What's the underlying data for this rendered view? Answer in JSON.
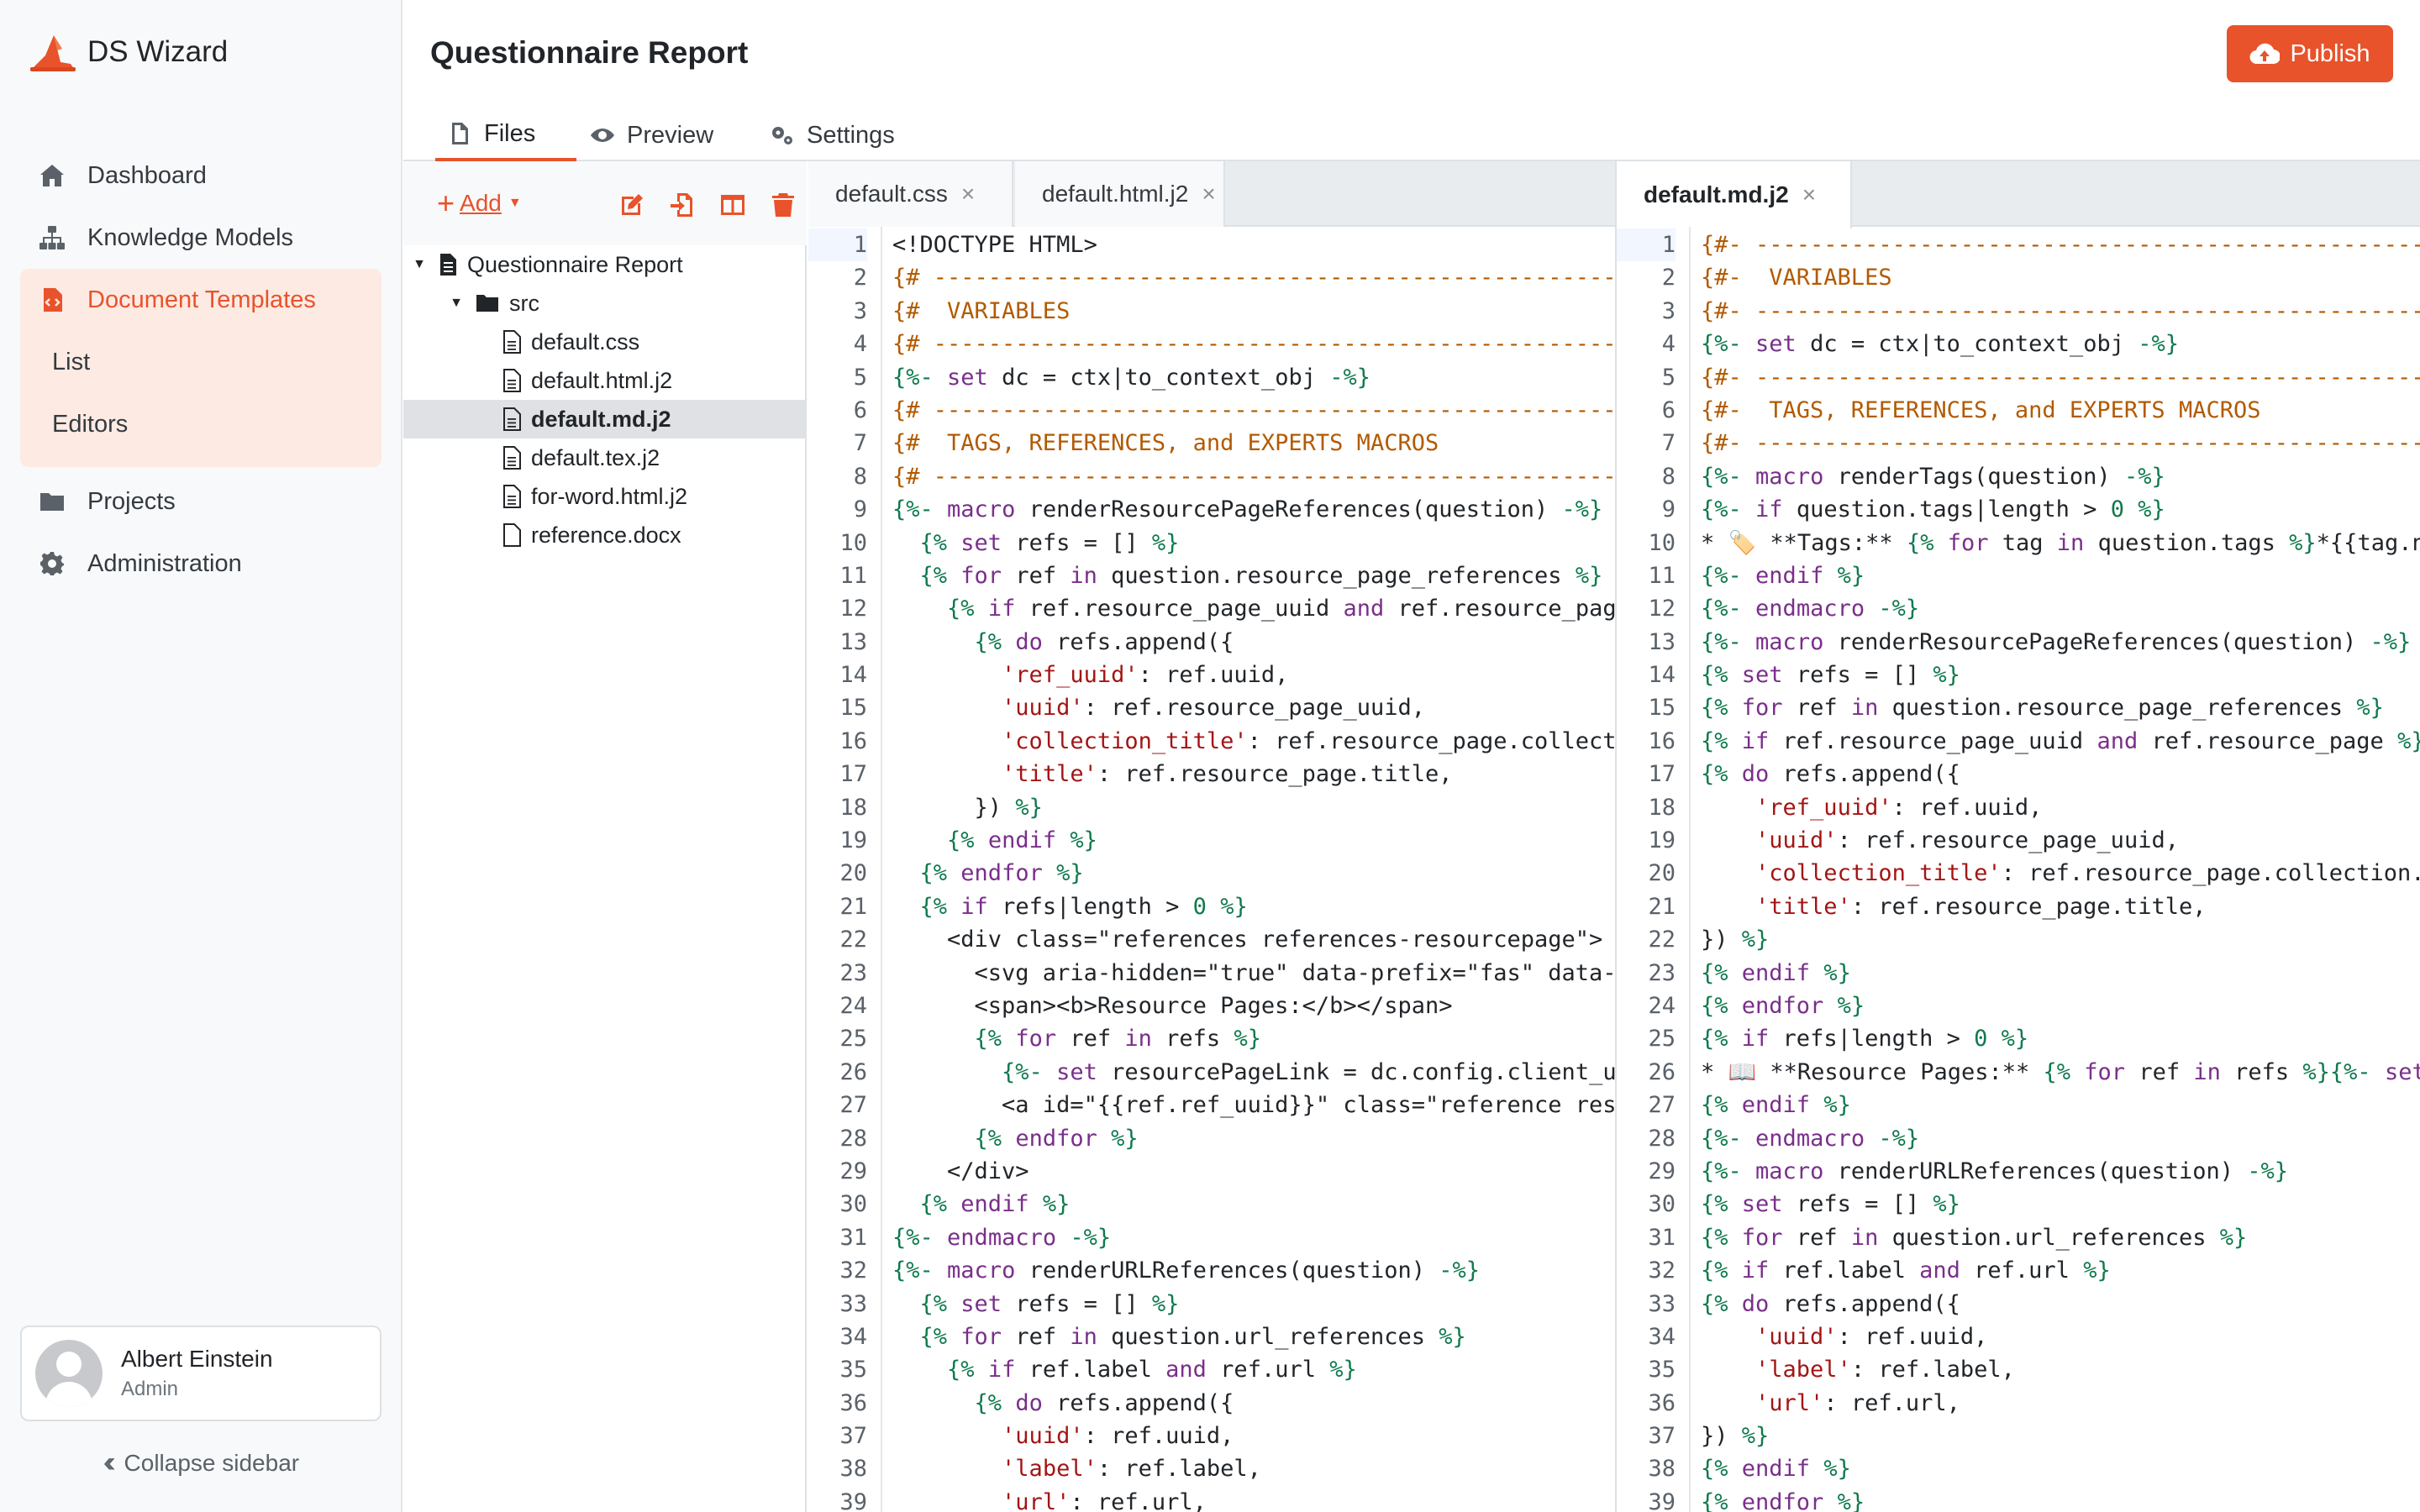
{
  "app": {
    "name": "DS Wizard"
  },
  "sidebar": {
    "items": [
      {
        "label": "Dashboard",
        "icon": "home-icon"
      },
      {
        "label": "Knowledge Models",
        "icon": "sitemap-icon"
      },
      {
        "label": "Document Templates",
        "icon": "file-code-icon",
        "active": true,
        "children": [
          {
            "label": "List"
          },
          {
            "label": "Editors"
          }
        ]
      },
      {
        "label": "Projects",
        "icon": "folder-icon"
      },
      {
        "label": "Administration",
        "icon": "gear-icon"
      }
    ],
    "user": {
      "name": "Albert Einstein",
      "role": "Admin"
    },
    "collapse_label": "Collapse sidebar"
  },
  "header": {
    "title": "Questionnaire Report",
    "publish_label": "Publish",
    "tabs": [
      {
        "label": "Files",
        "active": true
      },
      {
        "label": "Preview"
      },
      {
        "label": "Settings"
      }
    ]
  },
  "tree": {
    "add_label": "Add",
    "root": "Questionnaire Report",
    "folder": "src",
    "files": [
      "default.css",
      "default.html.j2",
      "default.md.j2",
      "default.tex.j2",
      "for-word.html.j2",
      "reference.docx"
    ],
    "selected": "default.md.j2"
  },
  "colors": {
    "accent": "#e8532b",
    "keyword": "#7a2f8a",
    "tag": "#0f7a4d",
    "string": "#a31515",
    "comment": "#b35a00"
  },
  "editor_left": {
    "tabs": [
      {
        "label": "default.css"
      },
      {
        "label": "default.html.j2",
        "active": true
      }
    ],
    "lines": [
      "<!DOCTYPE HTML>",
      "{# ------------------------------------------------------------------",
      "{#  VARIABLES",
      "{# ------------------------------------------------------------------",
      "{%- set dc = ctx|to_context_obj -%}",
      "{# ------------------------------------------------------------------",
      "{#  TAGS, REFERENCES, and EXPERTS MACROS",
      "{# ------------------------------------------------------------------",
      "{%- macro renderResourcePageReferences(question) -%}",
      "  {% set refs = [] %}",
      "  {% for ref in question.resource_page_references %}",
      "    {% if ref.resource_page_uuid and ref.resource_page %}",
      "      {% do refs.append({",
      "        'ref_uuid': ref.uuid,",
      "        'uuid': ref.resource_page_uuid,",
      "        'collection_title': ref.resource_page.collection.title,",
      "        'title': ref.resource_page.title,",
      "      }) %}",
      "    {% endif %}",
      "  {% endfor %}",
      "  {% if refs|length > 0 %}",
      "    <div class=\"references references-resourcepage\">",
      "      <svg aria-hidden=\"true\" data-prefix=\"fas\" data-icon=\"book\">",
      "      <span><b>Resource Pages:</b></span>",
      "      {% for ref in refs %}",
      "        {%- set resourcePageLink = dc.config.client_url -%}",
      "        <a id=\"{{ref.ref_uuid}}\" class=\"reference resourcepage\">",
      "      {% endfor %}",
      "    </div>",
      "  {% endif %}",
      "{%- endmacro -%}",
      "{%- macro renderURLReferences(question) -%}",
      "  {% set refs = [] %}",
      "  {% for ref in question.url_references %}",
      "    {% if ref.label and ref.url %}",
      "      {% do refs.append({",
      "        'uuid': ref.uuid,",
      "        'label': ref.label,",
      "        'url': ref.url,"
    ]
  },
  "editor_right": {
    "tabs": [
      {
        "label": "default.md.j2",
        "active": true
      }
    ],
    "lines": [
      "{#- ----------------------------------------------------------------",
      "{#-  VARIABLES",
      "{#- ----------------------------------------------------------------",
      "{%- set dc = ctx|to_context_obj -%}",
      "{#- ----------------------------------------------------------------",
      "{#-  TAGS, REFERENCES, and EXPERTS MACROS",
      "{#- ----------------------------------------------------------------",
      "{%- macro renderTags(question) -%}",
      "{%- if question.tags|length > 0 %}",
      "* 🏷️ **Tags:** {% for tag in question.tags %}*{{tag.name}}*",
      "{%- endif %}",
      "{%- endmacro -%}",
      "{%- macro renderResourcePageReferences(question) -%}",
      "{% set refs = [] %}",
      "{% for ref in question.resource_page_references %}",
      "{% if ref.resource_page_uuid and ref.resource_page %}",
      "{% do refs.append({",
      "    'ref_uuid': ref.uuid,",
      "    'uuid': ref.resource_page_uuid,",
      "    'collection_title': ref.resource_page.collection.title,",
      "    'title': ref.resource_page.title,",
      "}) %}",
      "{% endif %}",
      "{% endfor %}",
      "{% if refs|length > 0 %}",
      "* 📖 **Resource Pages:** {% for ref in refs %}{%- set",
      "{% endif %}",
      "{%- endmacro -%}",
      "{%- macro renderURLReferences(question) -%}",
      "{% set refs = [] %}",
      "{% for ref in question.url_references %}",
      "{% if ref.label and ref.url %}",
      "{% do refs.append({",
      "    'uuid': ref.uuid,",
      "    'label': ref.label,",
      "    'url': ref.url,",
      "}) %}",
      "{% endif %}",
      "{% endfor %}"
    ]
  }
}
